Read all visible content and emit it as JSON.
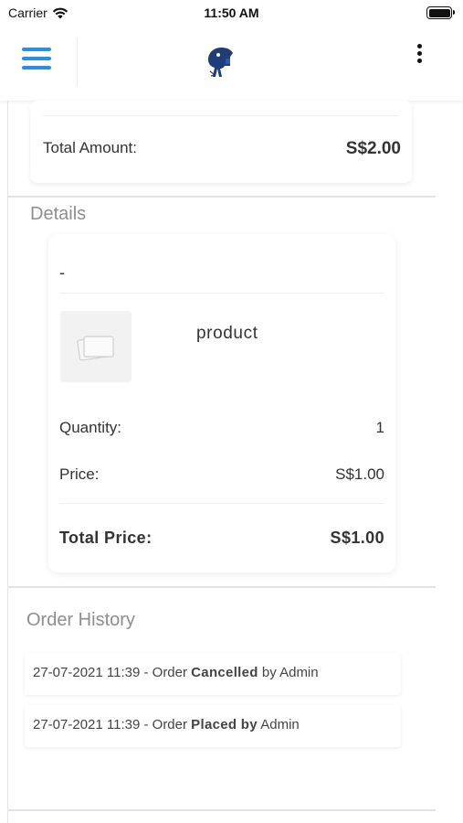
{
  "status_bar": {
    "carrier": "Carrier",
    "time": "11:50 AM"
  },
  "header": {
    "menu_icon": "hamburger-menu-icon",
    "logo_icon": "brand-logo-icon",
    "more_icon": "more-vertical-icon",
    "accent_color": "#2a8ee8"
  },
  "summary": {
    "total_amount_label": "Total Amount:",
    "total_amount_value": "S$2.00"
  },
  "details": {
    "title": "Details",
    "item_header": "-",
    "product_image_icon": "image-placeholder-icon",
    "product_name": "product",
    "quantity_label": "Quantity:",
    "quantity_value": "1",
    "price_label": "Price:",
    "price_value": "S$1.00",
    "total_price_label": "Total Price:",
    "total_price_value": "S$1.00"
  },
  "order_history": {
    "title": "Order History",
    "entries": [
      {
        "prefix": "27-07-2021 11:39 - Order ",
        "status": "Cancelled",
        "mid": " by ",
        "by": "Admin"
      },
      {
        "prefix": "27-07-2021 11:39 - Order ",
        "status": "Placed by",
        "mid": " ",
        "by": "Admin"
      }
    ]
  }
}
